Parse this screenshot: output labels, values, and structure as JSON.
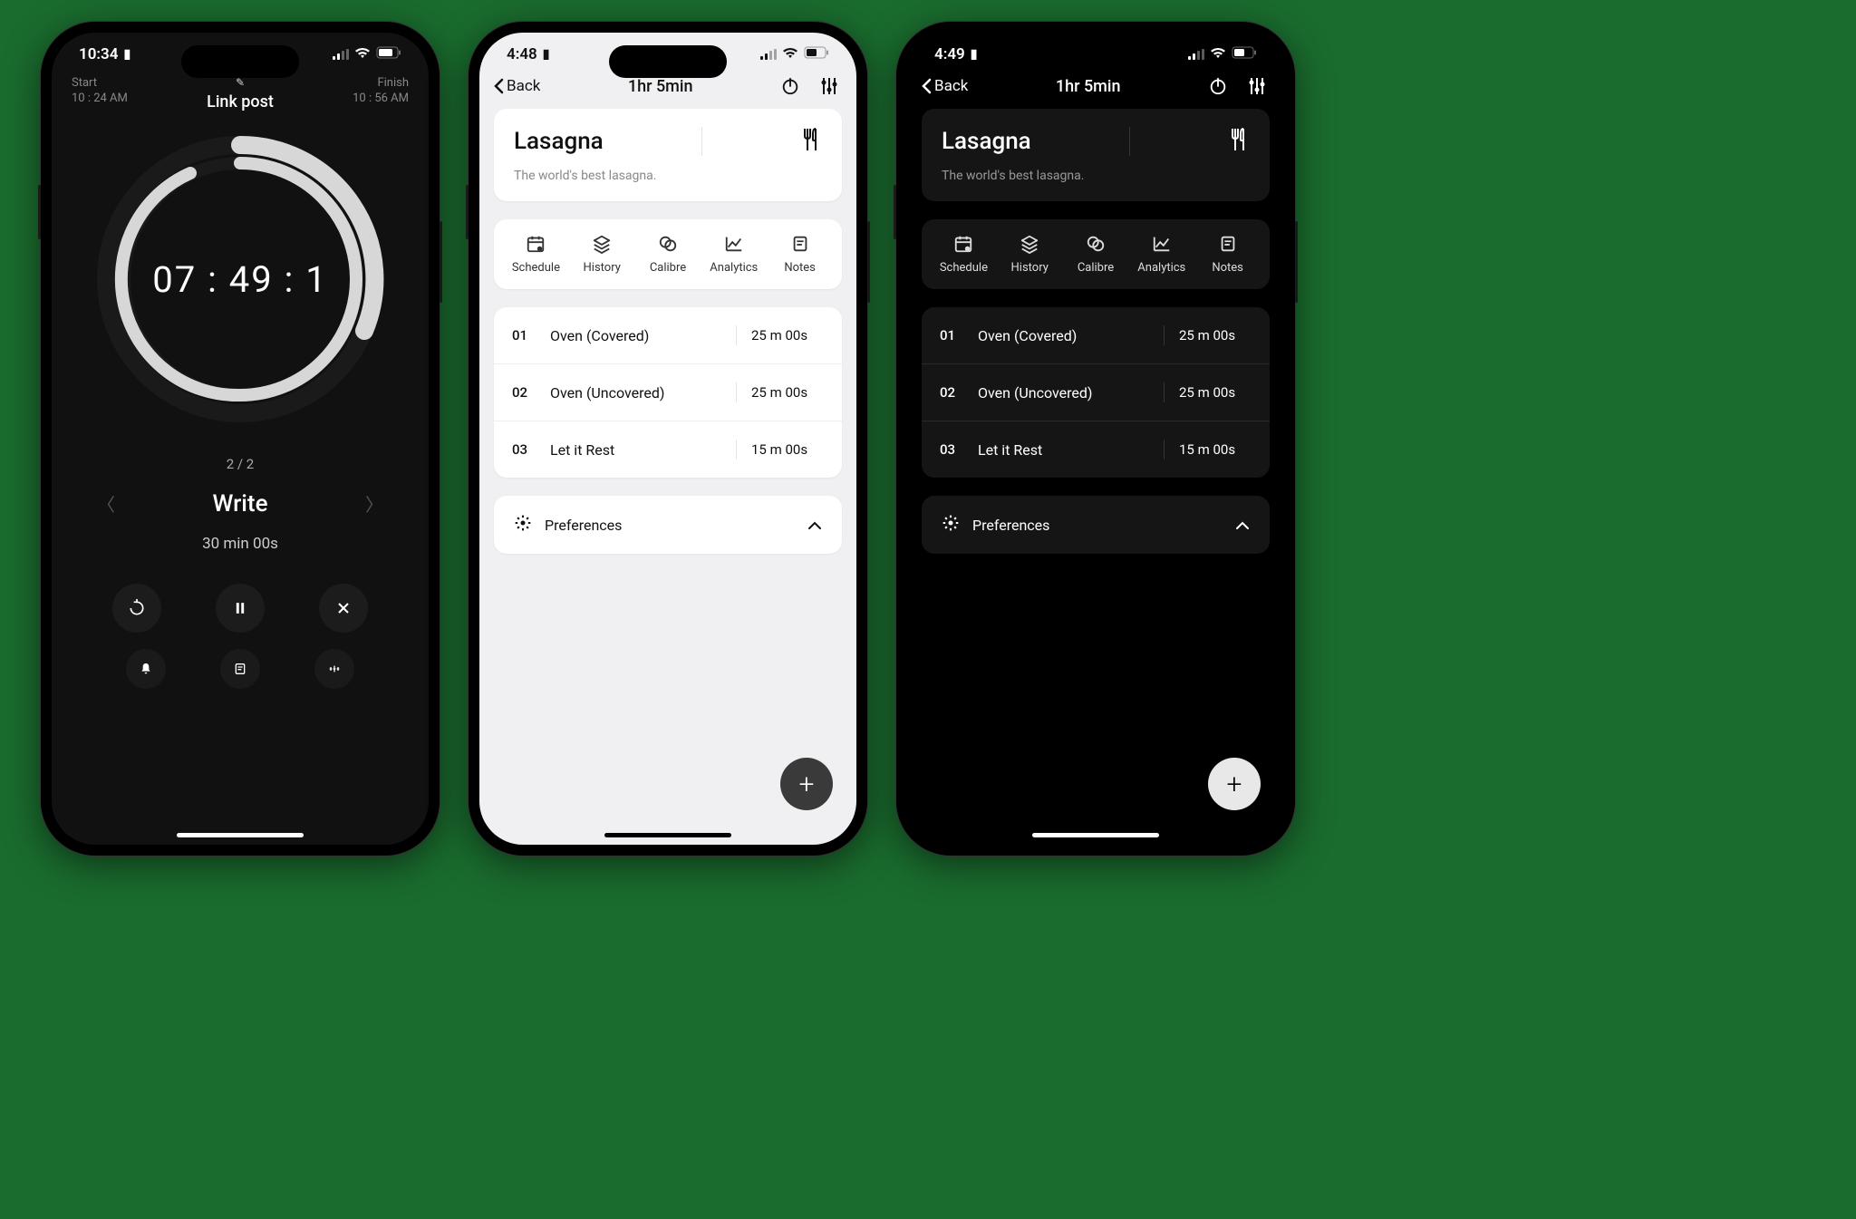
{
  "phone1": {
    "status_time": "10:34",
    "header": {
      "start_label": "Start",
      "start_time": "10 : 24 AM",
      "title": "Link post",
      "finish_label": "Finish",
      "finish_time": "10 : 56 AM"
    },
    "timer": "07 : 49 : 1",
    "step_index": "2 / 2",
    "step_title": "Write",
    "step_duration": "30 min 00s"
  },
  "phone2": {
    "status_time": "4:48",
    "back_label": "Back",
    "nav_title": "1hr 5min",
    "recipe_name": "Lasagna",
    "recipe_sub": "The world's best lasagna.",
    "tabs": {
      "schedule": "Schedule",
      "history": "History",
      "calibre": "Calibre",
      "analytics": "Analytics",
      "notes": "Notes"
    },
    "steps": [
      {
        "num": "01",
        "name": "Oven (Covered)",
        "dur": "25 m 00s"
      },
      {
        "num": "02",
        "name": "Oven (Uncovered)",
        "dur": "25 m 00s"
      },
      {
        "num": "03",
        "name": "Let it Rest",
        "dur": "15 m 00s"
      }
    ],
    "preferences_label": "Preferences"
  },
  "phone3": {
    "status_time": "4:49",
    "back_label": "Back",
    "nav_title": "1hr 5min",
    "recipe_name": "Lasagna",
    "recipe_sub": "The world's best lasagna.",
    "tabs": {
      "schedule": "Schedule",
      "history": "History",
      "calibre": "Calibre",
      "analytics": "Analytics",
      "notes": "Notes"
    },
    "steps": [
      {
        "num": "01",
        "name": "Oven (Covered)",
        "dur": "25 m 00s"
      },
      {
        "num": "02",
        "name": "Oven (Uncovered)",
        "dur": "25 m 00s"
      },
      {
        "num": "03",
        "name": "Let it Rest",
        "dur": "15 m 00s"
      }
    ],
    "preferences_label": "Preferences"
  }
}
